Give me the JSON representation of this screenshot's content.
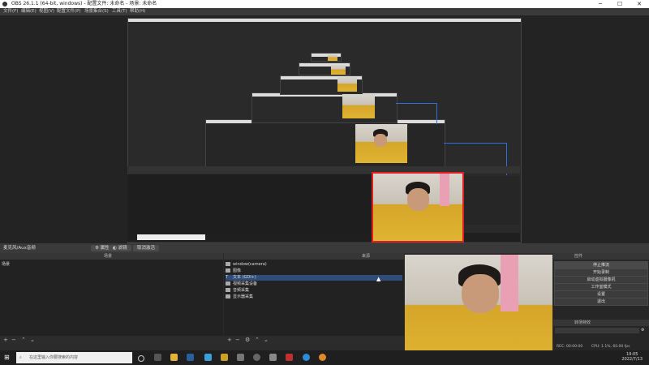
{
  "window": {
    "title": "OBS 26.1.1 (64-bit, windows) - 配置文件: 未命名 - 场景: 未命名"
  },
  "menubar": {
    "items": [
      "文件(F)",
      "编辑(E)",
      "视图(V)",
      "配置文件(P)",
      "场景集合(S)",
      "工具(T)",
      "帮助(H)"
    ]
  },
  "source_toolbar": {
    "audio_device": "麦克风/Aux音频",
    "properties": "属性",
    "filters": "滤镜",
    "deactivate": "取消激活"
  },
  "scenes_dock": {
    "header": "场景",
    "items": [
      "场景"
    ]
  },
  "sources_dock": {
    "header": "来源",
    "items": [
      "window(camera)",
      "图像",
      "文本 (GDI+)",
      "视频采集设备",
      "音频采集",
      "显示器采集"
    ]
  },
  "controls_dock": {
    "header": "控件",
    "buttons": [
      "停止推流",
      "开始录制",
      "启动虚拟摄像机",
      "工作室模式",
      "设置",
      "退出"
    ]
  },
  "transition_dock": {
    "header": "转场特效"
  },
  "status": {
    "rec": "REC: 00:00:00",
    "cpu": "CPU: 1.1%, 60.00 fps"
  },
  "taskbar": {
    "search_placeholder": "在这里输入你要搜索的内容",
    "time": "19:05",
    "date": "2022/7/13"
  },
  "colors": {
    "accent": "#e02020",
    "selected": "#2f4d78",
    "blue_line": "#2f6fd8"
  }
}
